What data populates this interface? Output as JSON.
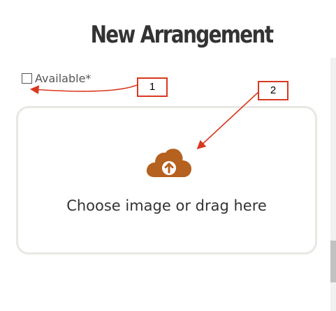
{
  "header": {
    "title": "New Arrangement"
  },
  "form": {
    "available_label": "Available*",
    "available_checked": false
  },
  "upload": {
    "prompt": "Choose image or drag here",
    "icon": "cloud-upload-icon",
    "icon_color": "#b5611f"
  },
  "annotations": {
    "callout_1": "1",
    "callout_2": "2",
    "color": "#d9381e"
  }
}
